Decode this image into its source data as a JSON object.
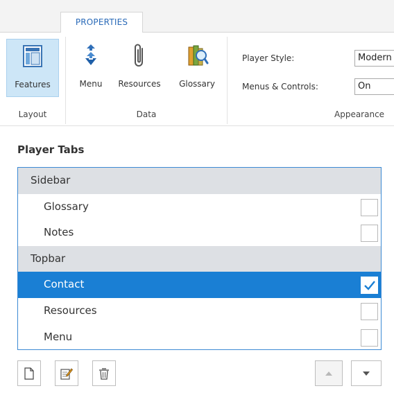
{
  "ribbon": {
    "tab_label": "PROPERTIES",
    "groups": {
      "layout": "Layout",
      "data": "Data",
      "appearance": "Appearance"
    },
    "buttons": {
      "features": "Features",
      "menu": "Menu",
      "resources": "Resources",
      "glossary": "Glossary"
    },
    "fields": {
      "player_style_label": "Player Style:",
      "player_style_value": "Modern",
      "menus_controls_label": "Menus & Controls:",
      "menus_controls_value": "On"
    }
  },
  "player_tabs": {
    "title": "Player Tabs",
    "rows": [
      {
        "type": "group",
        "label": "Sidebar"
      },
      {
        "type": "item",
        "label": "Glossary",
        "checked": false,
        "selected": false
      },
      {
        "type": "item",
        "label": "Notes",
        "checked": false,
        "selected": false
      },
      {
        "type": "group",
        "label": "Topbar"
      },
      {
        "type": "item",
        "label": "Contact",
        "checked": true,
        "selected": true
      },
      {
        "type": "item",
        "label": "Resources",
        "checked": false,
        "selected": false
      },
      {
        "type": "item",
        "label": "Menu",
        "checked": false,
        "selected": false
      }
    ]
  },
  "colors": {
    "selection": "#1a7fd4",
    "accent": "#2a6ab8",
    "group_row": "#dde0e4"
  },
  "icons": {
    "features": "layout-features-icon",
    "menu": "menu-arrow-icon",
    "resources": "paperclip-icon",
    "glossary": "books-magnifier-icon",
    "new": "new-page-icon",
    "edit": "edit-pencil-icon",
    "delete": "trash-icon",
    "up": "move-up-icon",
    "down": "move-down-icon"
  }
}
